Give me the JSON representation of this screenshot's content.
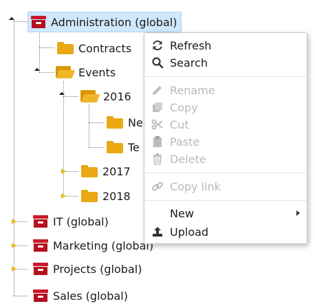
{
  "tree": {
    "nodes": [
      {
        "label": "Administration (global)",
        "type": "archive",
        "state": "selected"
      },
      {
        "label": "Contracts",
        "type": "folder"
      },
      {
        "label": "Events",
        "type": "folder-open"
      },
      {
        "label": "2016",
        "type": "folder-open"
      },
      {
        "label": "Ne",
        "type": "folder"
      },
      {
        "label": "Te",
        "type": "folder"
      },
      {
        "label": "2017",
        "type": "folder"
      },
      {
        "label": "2018",
        "type": "folder"
      },
      {
        "label": "IT (global)",
        "type": "archive"
      },
      {
        "label": "Marketing (global)",
        "type": "archive"
      },
      {
        "label": "Projects (global)",
        "type": "archive"
      },
      {
        "label": "Sales (global)",
        "type": "archive"
      }
    ]
  },
  "context_menu": {
    "refresh": "Refresh",
    "search": "Search",
    "rename": "Rename",
    "copy": "Copy",
    "cut": "Cut",
    "paste": "Paste",
    "delete": "Delete",
    "copy_link": "Copy link",
    "new": "New",
    "upload": "Upload"
  },
  "colors": {
    "selection_bg": "#cfe8fc",
    "archive_red": "#c9182b",
    "folder_yellow": "#e8a914",
    "disabled_text": "#b8b8b8"
  }
}
